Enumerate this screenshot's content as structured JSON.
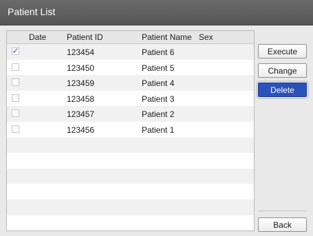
{
  "window": {
    "title": "Patient List"
  },
  "table": {
    "columns": [
      "Date",
      "Patient ID",
      "Patient Name",
      "Sex"
    ],
    "rows": [
      {
        "checked": true,
        "date": "",
        "patient_id": "123454",
        "patient_name": "Patient 6",
        "sex": ""
      },
      {
        "checked": false,
        "date": "",
        "patient_id": "123450",
        "patient_name": "Patient 5",
        "sex": ""
      },
      {
        "checked": false,
        "date": "",
        "patient_id": "123459",
        "patient_name": "Patient 4",
        "sex": ""
      },
      {
        "checked": false,
        "date": "",
        "patient_id": "123458",
        "patient_name": "Patient 3",
        "sex": ""
      },
      {
        "checked": false,
        "date": "",
        "patient_id": "123457",
        "patient_name": "Patient 2",
        "sex": ""
      },
      {
        "checked": false,
        "date": "",
        "patient_id": "123456",
        "patient_name": "Patient 1",
        "sex": ""
      }
    ]
  },
  "buttons": {
    "execute": "Execute",
    "change": "Change",
    "delete": "Delete",
    "back": "Back"
  },
  "icons": {
    "checkmark": "✓"
  }
}
